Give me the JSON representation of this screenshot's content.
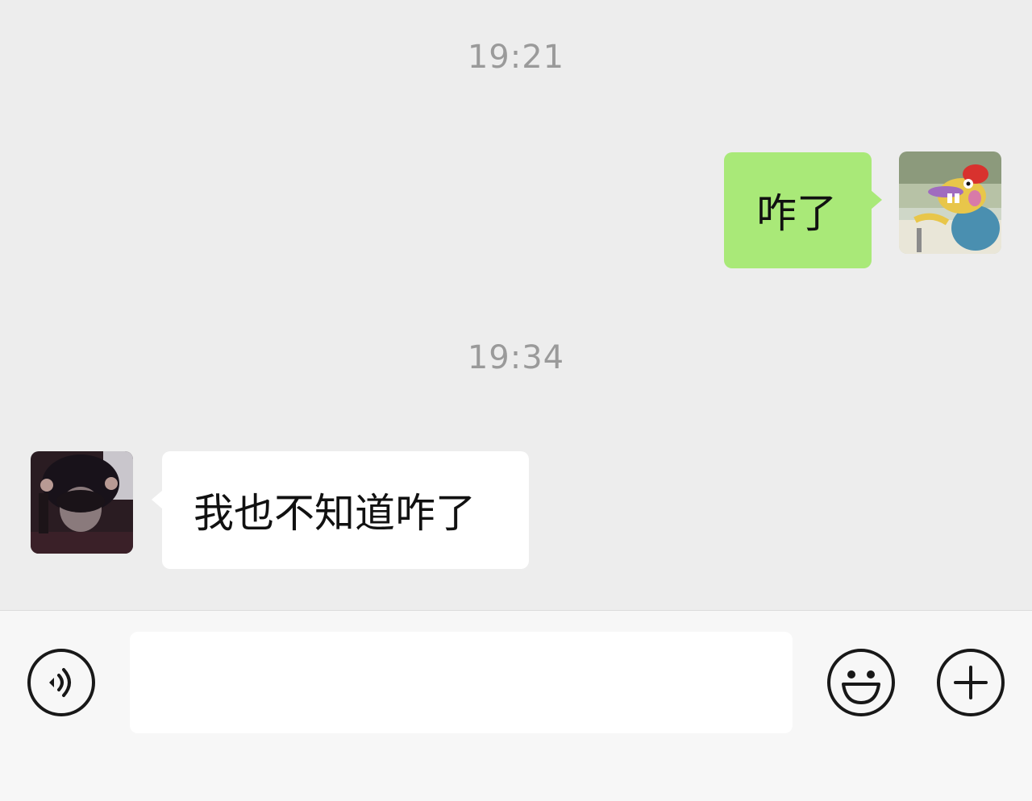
{
  "chat": {
    "messages": [
      {
        "type": "timestamp",
        "text": "19:21"
      },
      {
        "type": "outgoing",
        "text": "咋了",
        "avatar": "cartoon-fish-sticker-avatar"
      },
      {
        "type": "timestamp",
        "text": "19:34"
      },
      {
        "type": "incoming",
        "text": "我也不知道咋了",
        "avatar": "hooded-person-photo-avatar"
      }
    ]
  },
  "input_bar": {
    "voice_icon": "voice-icon",
    "input_value": "",
    "emoji_icon": "emoji-icon",
    "plus_icon": "plus-icon"
  },
  "colors": {
    "chat_background": "#ededed",
    "outgoing_bubble": "#a9e978",
    "incoming_bubble": "#ffffff",
    "timestamp_text": "#9a9a9a",
    "input_bar_background": "#f7f7f7"
  }
}
